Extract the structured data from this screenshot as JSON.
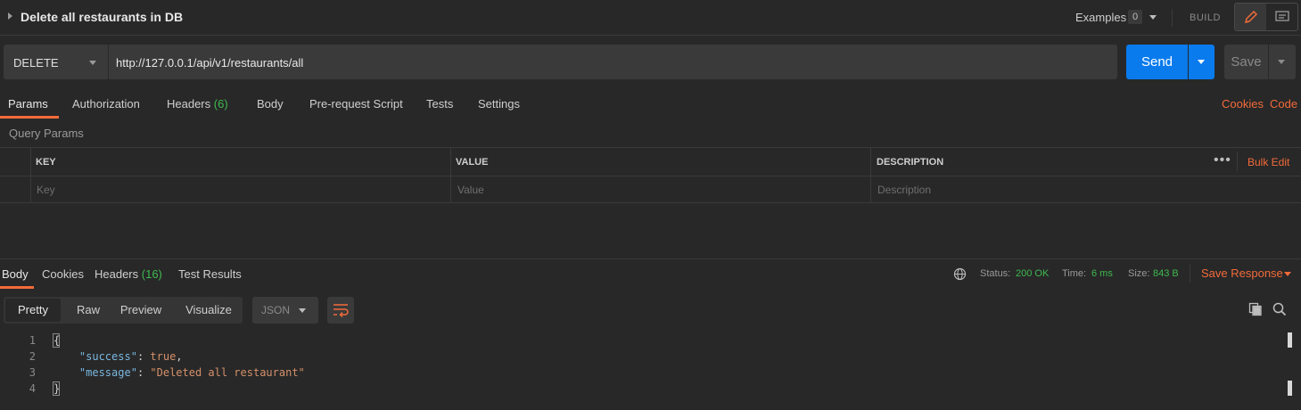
{
  "title_bar": {
    "request_name": "Delete all restaurants in DB",
    "examples_label": "Examples",
    "examples_count": "0",
    "build_label": "BUILD"
  },
  "url_bar": {
    "method": "DELETE",
    "url": "http://127.0.0.1/api/v1/restaurants/all",
    "send_label": "Send",
    "save_label": "Save"
  },
  "request_tabs": [
    {
      "label": "Params",
      "count": ""
    },
    {
      "label": "Authorization",
      "count": ""
    },
    {
      "label": "Headers",
      "count": "(6)"
    },
    {
      "label": "Body",
      "count": ""
    },
    {
      "label": "Pre-request Script",
      "count": ""
    },
    {
      "label": "Tests",
      "count": ""
    },
    {
      "label": "Settings",
      "count": ""
    }
  ],
  "right_links": {
    "cookies": "Cookies",
    "code": "Code"
  },
  "query_params": {
    "section_label": "Query Params",
    "columns": [
      "KEY",
      "VALUE",
      "DESCRIPTION"
    ],
    "placeholders": [
      "Key",
      "Value",
      "Description"
    ],
    "bulk_edit": "Bulk Edit"
  },
  "response": {
    "tabs": [
      {
        "label": "Body",
        "count": ""
      },
      {
        "label": "Cookies",
        "count": ""
      },
      {
        "label": "Headers",
        "count": "(16)"
      },
      {
        "label": "Test Results",
        "count": ""
      }
    ],
    "status_label": "Status:",
    "status_value": "200 OK",
    "time_label": "Time:",
    "time_value": "6 ms",
    "size_label": "Size:",
    "size_value": "843 B",
    "save_response": "Save Response",
    "view_modes": [
      "Pretty",
      "Raw",
      "Preview",
      "Visualize"
    ],
    "format": "JSON",
    "code_lines": [
      {
        "n": "1"
      },
      {
        "n": "2",
        "key": "\"success\"",
        "value": "true"
      },
      {
        "n": "3",
        "key": "\"message\"",
        "value": "\"Deleted all restaurant\""
      },
      {
        "n": "4"
      }
    ]
  },
  "colors": {
    "accent": "#f26b3a",
    "send": "#097bed",
    "ok": "#3fb950",
    "background": "#282828"
  }
}
